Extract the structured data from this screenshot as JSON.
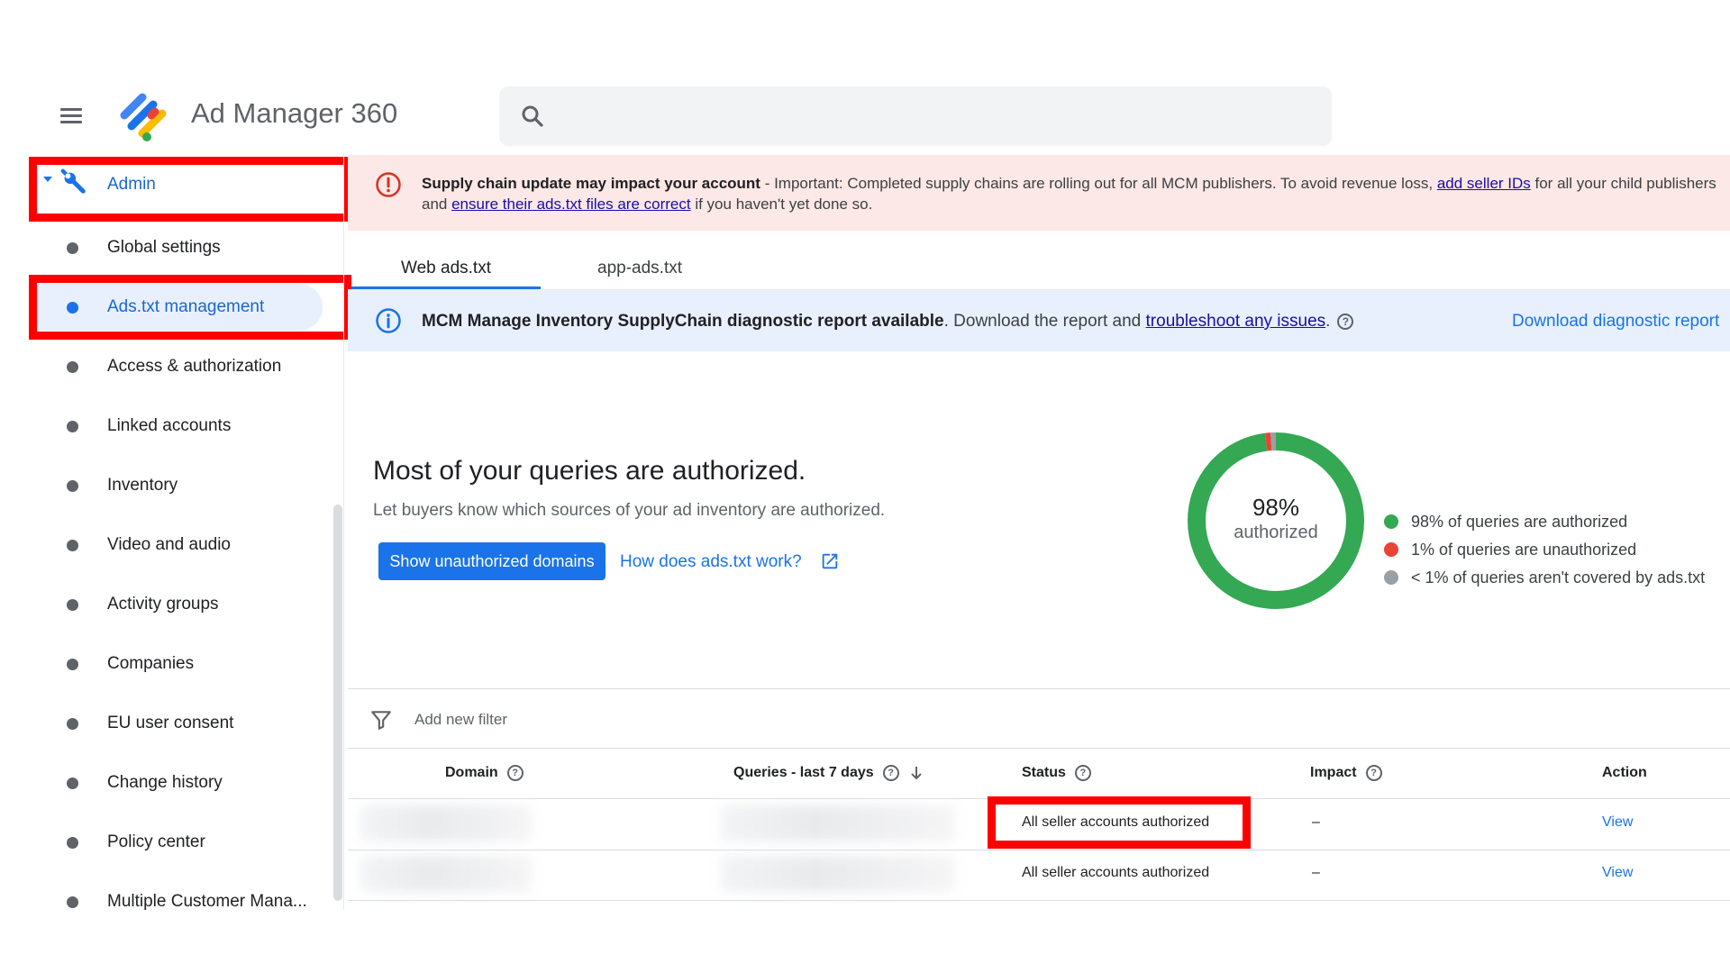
{
  "app": {
    "title": "Ad Manager 360"
  },
  "search": {
    "placeholder": ""
  },
  "sidebar": {
    "items": [
      {
        "label": "Admin"
      },
      {
        "label": "Global settings"
      },
      {
        "label": "Ads.txt management"
      },
      {
        "label": "Access & authorization"
      },
      {
        "label": "Linked accounts"
      },
      {
        "label": "Inventory"
      },
      {
        "label": "Video and audio"
      },
      {
        "label": "Activity groups"
      },
      {
        "label": "Companies"
      },
      {
        "label": "EU user consent"
      },
      {
        "label": "Change history"
      },
      {
        "label": "Policy center"
      },
      {
        "label": "Multiple Customer Mana..."
      }
    ]
  },
  "alert": {
    "title": "Supply chain update may impact your account",
    "text1": " - Important: Completed supply chains are rolling out for all MCM publishers. To avoid revenue loss, ",
    "link1": "add seller IDs",
    "text2": " for all your child publishers",
    "text3": "and ",
    "link2": "ensure their ads.txt files are correct",
    "text4": " if you haven't yet done so."
  },
  "tabs": [
    {
      "label": "Web ads.txt"
    },
    {
      "label": "app-ads.txt"
    }
  ],
  "info": {
    "bold": "MCM Manage Inventory SupplyChain diagnostic report available",
    "text": ". Download the report and ",
    "link": "troubleshoot any issues",
    "end": ".",
    "help": "?",
    "download": "Download diagnostic report"
  },
  "summary": {
    "title": "Most of your queries are authorized.",
    "subtitle": "Let buyers know which sources of your ad inventory are authorized.",
    "button": "Show unauthorized domains",
    "link": "How does ads.txt work?"
  },
  "donut": {
    "percent_text": "98%",
    "label": "authorized",
    "segments": [
      {
        "value": 98,
        "color": "#34a853"
      },
      {
        "value": 1,
        "color": "#ea4335"
      },
      {
        "value": 1,
        "color": "#9aa0a6"
      }
    ],
    "legend": [
      {
        "text": "98% of queries are authorized",
        "color": "#34a853"
      },
      {
        "text": "1% of queries are unauthorized",
        "color": "#ea4335"
      },
      {
        "text": "< 1% of queries aren't covered by ads.txt",
        "color": "#9aa0a6"
      }
    ]
  },
  "filter": {
    "label": "Add new filter"
  },
  "table": {
    "headers": {
      "domain": "Domain",
      "queries": "Queries - last 7 days",
      "status": "Status",
      "impact": "Impact",
      "action": "Action"
    },
    "help": "?",
    "rows": [
      {
        "status": "All seller accounts authorized",
        "impact": "–",
        "action": "View"
      },
      {
        "status": "All seller accounts authorized",
        "impact": "–",
        "action": "View"
      }
    ]
  },
  "colors": {
    "accent": "#1a73e8",
    "highlight_box": "#ff0000",
    "alert_bg": "#fce8e6",
    "info_bg": "#e8f0fe"
  }
}
